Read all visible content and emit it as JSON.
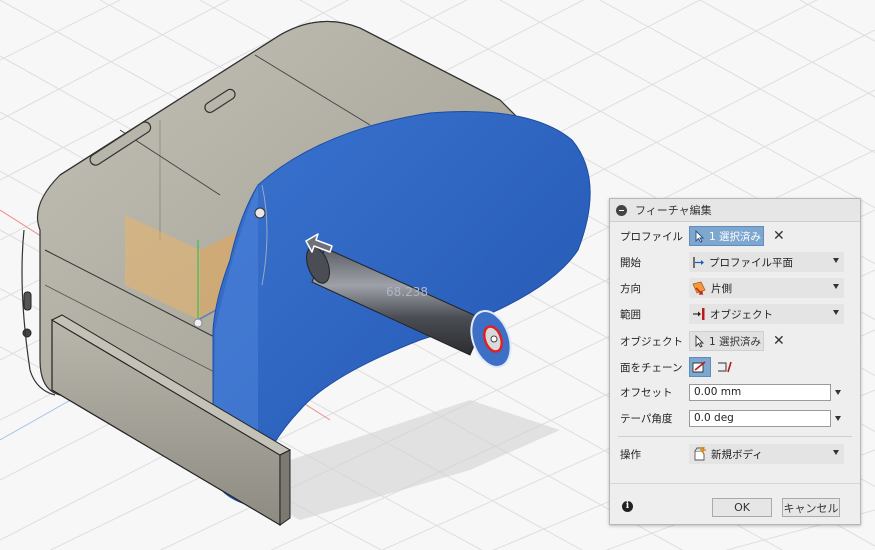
{
  "viewport": {
    "dimension_label": "68.238"
  },
  "panel": {
    "title": "フィーチャ編集",
    "rows": {
      "profile": {
        "label": "プロファイル",
        "value": "1 選択済み"
      },
      "start": {
        "label": "開始",
        "value": "プロファイル平面"
      },
      "direction": {
        "label": "方向",
        "value": "片側"
      },
      "extent": {
        "label": "範囲",
        "value": "オブジェクト"
      },
      "object": {
        "label": "オブジェクト",
        "value": "1 選択済み"
      },
      "chain_faces": {
        "label": "面をチェーン"
      },
      "offset": {
        "label": "オフセット",
        "value": "0.00 mm"
      },
      "taper": {
        "label": "テーパ角度",
        "value": "0.0 deg"
      },
      "operation": {
        "label": "操作",
        "value": "新規ボディ"
      }
    },
    "ok_label": "OK",
    "cancel_label": "キャンセル",
    "info_glyph": "i"
  },
  "colors": {
    "selection_blue": "#2f66c4",
    "body_gray": "#aeaba1",
    "grid_bg": "#f7f7f7",
    "button_active": "#7da7cf"
  }
}
